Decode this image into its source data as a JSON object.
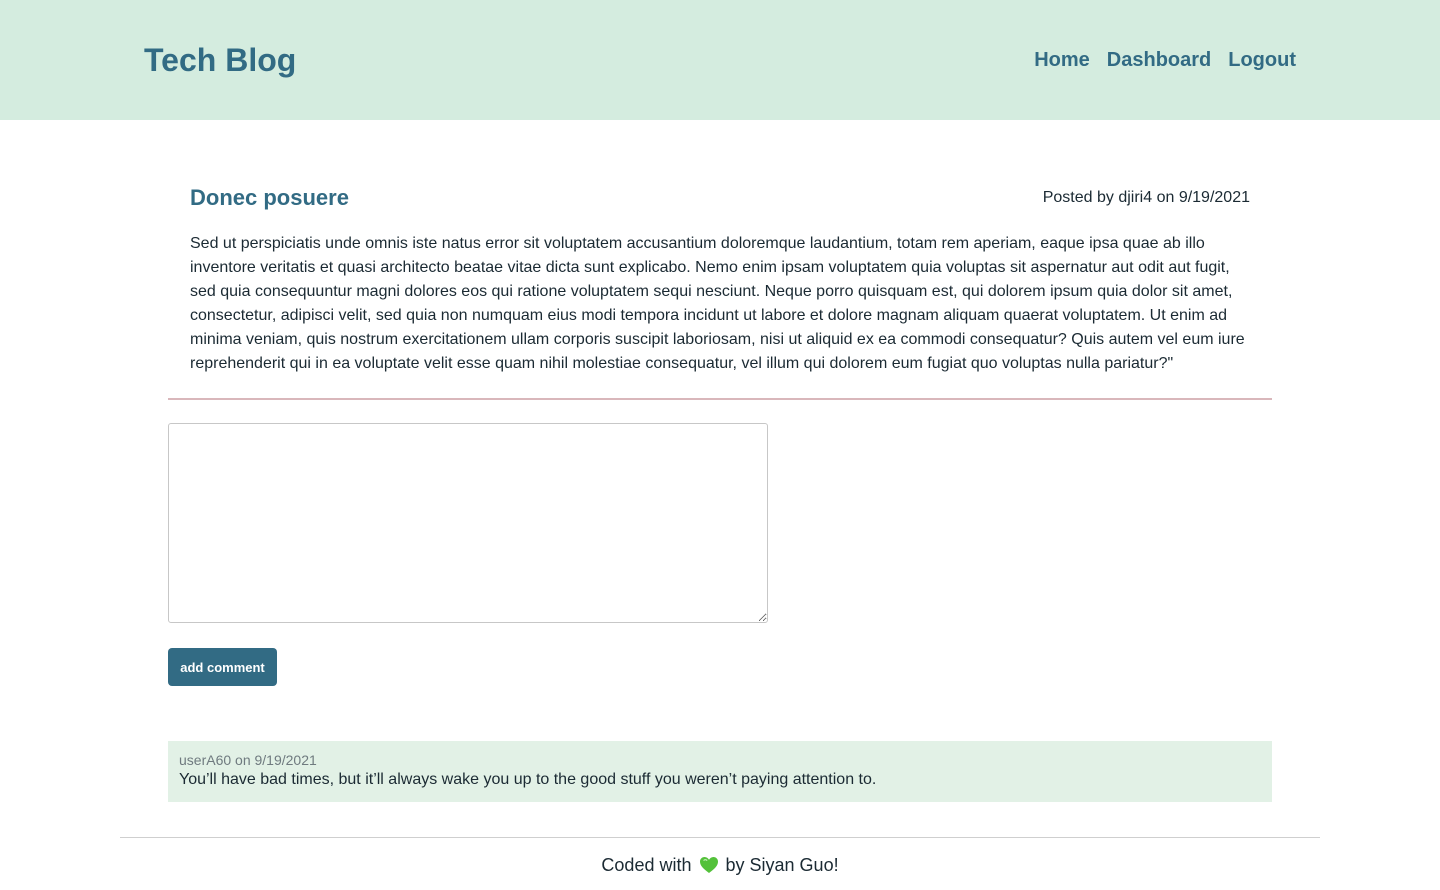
{
  "header": {
    "brand": "Tech Blog",
    "nav": {
      "home": "Home",
      "dashboard": "Dashboard",
      "logout": "Logout"
    }
  },
  "post": {
    "title": "Donec posuere",
    "meta": "Posted by djiri4 on 9/19/2021",
    "body": "Sed ut perspiciatis unde omnis iste natus error sit voluptatem accusantium doloremque laudantium, totam rem aperiam, eaque ipsa quae ab illo inventore veritatis et quasi architecto beatae vitae dicta sunt explicabo. Nemo enim ipsam voluptatem quia voluptas sit aspernatur aut odit aut fugit, sed quia consequuntur magni dolores eos qui ratione voluptatem sequi nesciunt. Neque porro quisquam est, qui dolorem ipsum quia dolor sit amet, consectetur, adipisci velit, sed quia non numquam eius modi tempora incidunt ut labore et dolore magnam aliquam quaerat voluptatem. Ut enim ad minima veniam, quis nostrum exercitationem ullam corporis suscipit laboriosam, nisi ut aliquid ex ea commodi consequatur? Quis autem vel eum iure reprehenderit qui in ea voluptate velit esse quam nihil molestiae consequatur, vel illum qui dolorem eum fugiat quo voluptas nulla pariatur?\""
  },
  "comment_form": {
    "value": "",
    "submit_label": "add comment"
  },
  "comments": [
    {
      "meta": "userA60 on 9/19/2021",
      "text": "You’ll have bad times, but it’ll always wake you up to the good stuff you weren’t paying attention to."
    }
  ],
  "footer": {
    "prefix": "Coded with",
    "icon": "green-heart-icon",
    "suffix": "by Siyan Guo!"
  },
  "colors": {
    "header_bg": "#d4ecdf",
    "accent": "#326b84",
    "comment_bg": "#e2f1e6",
    "divider": "#d9b7bb"
  }
}
